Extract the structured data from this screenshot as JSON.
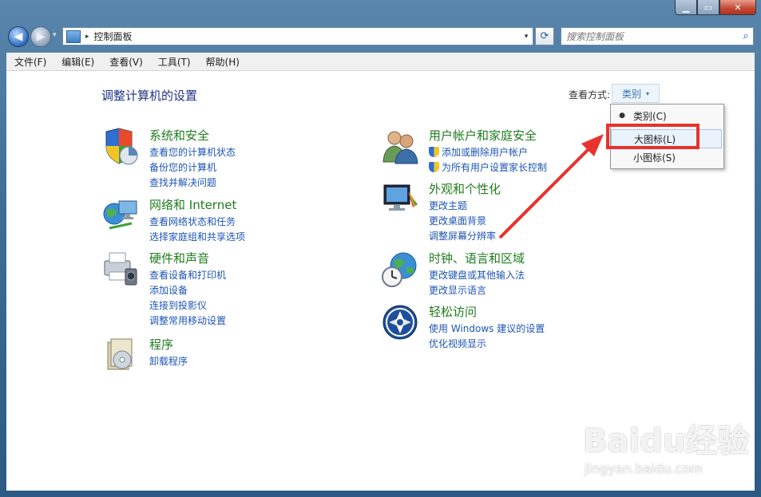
{
  "titlebar": {
    "min_label": "▁",
    "max_label": "▭",
    "close_label": "✕"
  },
  "nav": {
    "back_icon": "◀",
    "forward_icon": "▶",
    "history_icon": "▾",
    "address_sep": "▸",
    "address_path": "控制面板",
    "address_dropdown": "▾",
    "refresh_icon": "⟳",
    "search_placeholder": "搜索控制面板",
    "search_icon": "⌕"
  },
  "menu": [
    "文件(F)",
    "编辑(E)",
    "查看(V)",
    "工具(T)",
    "帮助(H)"
  ],
  "page_title": "调整计算机的设置",
  "view_by": {
    "label": "查看方式:",
    "value": "类别",
    "arrow": "▾"
  },
  "categories": [
    {
      "title": "系统和安全",
      "links": [
        "查看您的计算机状态",
        "备份您的计算机",
        "查找并解决问题"
      ]
    },
    {
      "title": "网络和 Internet",
      "links": [
        "查看网络状态和任务",
        "选择家庭组和共享选项"
      ]
    },
    {
      "title": "硬件和声音",
      "links": [
        "查看设备和打印机",
        "添加设备",
        "连接到投影仪",
        "调整常用移动设置"
      ]
    },
    {
      "title": "程序",
      "links": [
        "卸载程序"
      ]
    },
    {
      "title": "用户帐户和家庭安全",
      "links": [
        "添加或删除用户帐户",
        "为所有用户设置家长控制"
      ]
    },
    {
      "title": "外观和个性化",
      "links": [
        "更改主题",
        "更改桌面背景",
        "调整屏幕分辨率"
      ]
    },
    {
      "title": "时钟、语言和区域",
      "links": [
        "更改键盘或其他输入法",
        "更改显示语言"
      ]
    },
    {
      "title": "轻松访问",
      "links": [
        "使用 Windows 建议的设置",
        "优化视频显示"
      ]
    }
  ],
  "dropdown": {
    "items": [
      "类别(C)",
      "大图标(L)",
      "小图标(S)"
    ],
    "selected_marker": "●"
  },
  "colors": {
    "accent_link": "#1c55b4",
    "category_title": "#1e7d1e",
    "annotation": "#e8322d"
  },
  "watermark": {
    "line1": "Baidu经验",
    "line2": "jingyan.baidu.com"
  }
}
